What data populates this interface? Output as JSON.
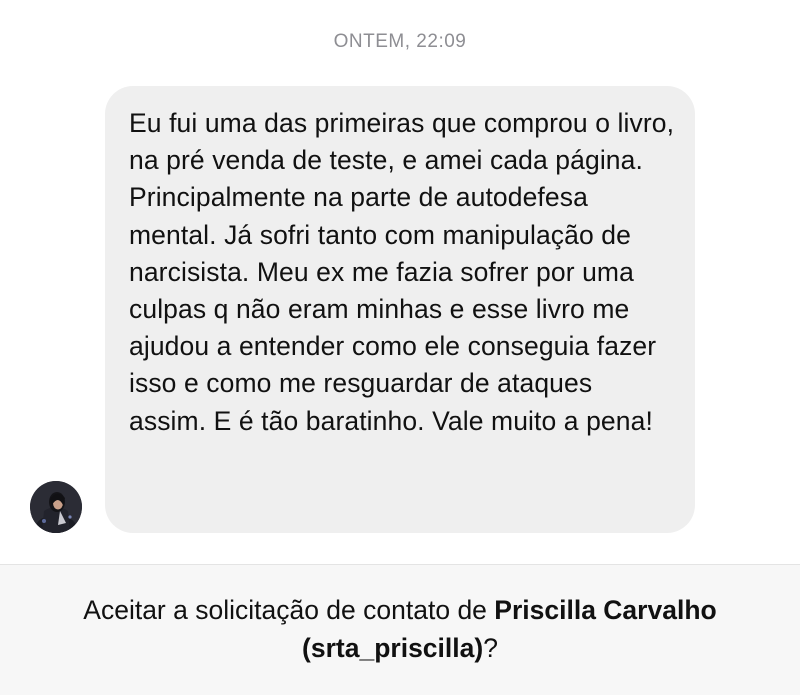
{
  "conversation": {
    "timestamp": "ONTEM, 22:09",
    "message": {
      "text": "Eu fui uma das primeiras que comprou o livro, na pré venda de teste, e amei cada página. Principalmente na parte de autodefesa mental. Já sofri tanto com manipulação de narcisista. Meu ex me fazia sofrer por uma culpas q não eram minhas e esse livro me ajudou a entender como ele conseguia fazer isso e como me resguardar de ataques assim. E é tão baratinho. Vale muito a pena!"
    }
  },
  "contact_request": {
    "prefix": "Aceitar a solicitação de contato de ",
    "name": "Priscilla Carvalho",
    "username_paren": "(srta_priscilla)",
    "suffix": "?"
  },
  "colors": {
    "bubble_background": "#efefef",
    "timestamp_text": "#8e8e93",
    "request_bar_background": "#f7f7f7"
  }
}
